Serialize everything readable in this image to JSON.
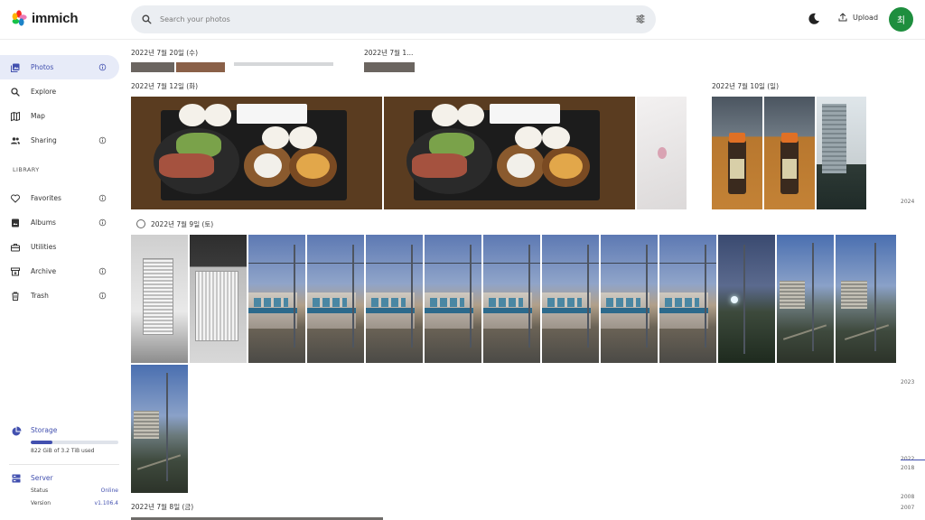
{
  "app": {
    "name": "immich"
  },
  "search": {
    "placeholder": "Search your photos"
  },
  "header": {
    "upload_label": "Upload",
    "avatar_initial": "최"
  },
  "sidebar": {
    "items": [
      {
        "label": "Photos",
        "icon": "photos-icon",
        "active": true,
        "info": true
      },
      {
        "label": "Explore",
        "icon": "magnify-icon",
        "info": false
      },
      {
        "label": "Map",
        "icon": "map-icon",
        "info": false
      },
      {
        "label": "Sharing",
        "icon": "account-multiple-icon",
        "info": true
      }
    ],
    "library_label": "LIBRARY",
    "library_items": [
      {
        "label": "Favorites",
        "icon": "heart-icon",
        "info": true
      },
      {
        "label": "Albums",
        "icon": "album-icon",
        "info": true
      },
      {
        "label": "Utilities",
        "icon": "toolbox-icon",
        "info": false
      },
      {
        "label": "Archive",
        "icon": "archive-icon",
        "info": true
      },
      {
        "label": "Trash",
        "icon": "trash-icon",
        "info": true
      }
    ]
  },
  "storage": {
    "title": "Storage",
    "usage_text": "822 GiB of 3.2 TiB used",
    "used_fraction": 0.25
  },
  "server": {
    "title": "Server",
    "status_label": "Status",
    "status_value": "Online",
    "version_label": "Version",
    "version_value": "v1.106.4"
  },
  "timeline": {
    "groups": {
      "g1": "2022년 7월 20일 (수)",
      "g2": "2022년 7월 1...",
      "g3": "2022년 7월 12일 (화)",
      "g4": "2022년 7월 10일 (일)",
      "g5": "2022년 7월 9일 (토)",
      "g6": "2022년 7월 8일 (금)"
    },
    "years": {
      "y2024": "2024",
      "y2023": "2023",
      "y2022": "2022",
      "y2018": "2018",
      "y2008": "2008",
      "y2007": "2007"
    }
  },
  "colors": {
    "accent": "#4250af",
    "active_bg": "#e7ebf8",
    "avatar_bg": "#1e8e3e",
    "online": "#4250af"
  }
}
